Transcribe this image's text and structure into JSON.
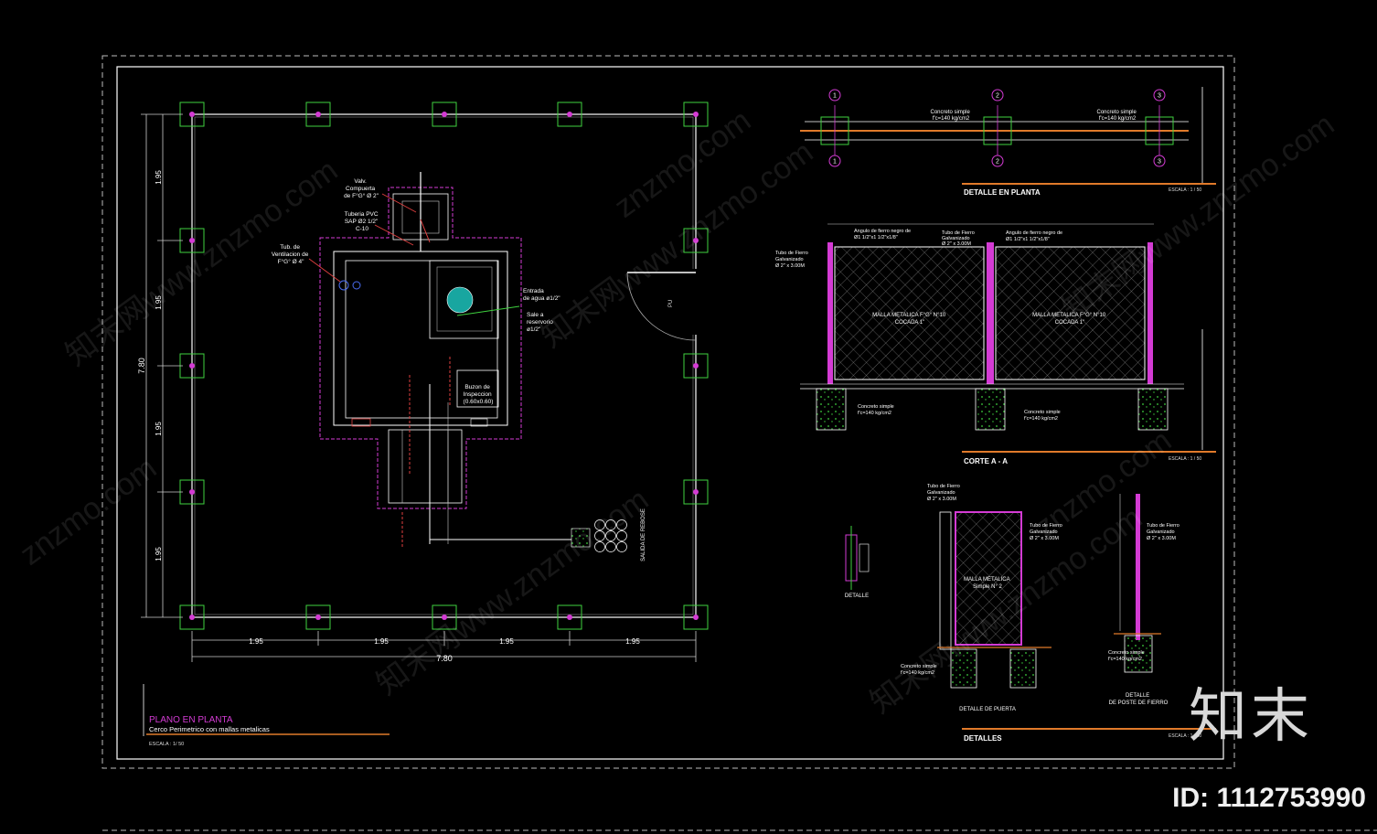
{
  "plan": {
    "title": "PLANO EN PLANTA",
    "subtitle": "Cerco Perimetrico con mallas metalicas",
    "scale": "ESCALA : 1/ 50",
    "dim_segment": "1.95",
    "dim_total": "7.80"
  },
  "notes": {
    "valve": [
      "Valv.",
      "Compuerta",
      "de F°G° Ø 2\""
    ],
    "pvc": [
      "Tuberia PVC",
      "SAP Ø2 1/2\"",
      "C-10"
    ],
    "vent": [
      "Tub. de",
      "Ventilacion de",
      "F°G° Ø 4\""
    ],
    "inlet": [
      "Entrada",
      "de agua ø1/2\""
    ],
    "outlet": [
      "Sale a",
      "reservorio",
      "ø1/2\""
    ],
    "buzon": [
      "Buzon de",
      "Inspeccion",
      "(0.60x0.60)"
    ],
    "salida": "SALIDA DE REBOSE",
    "door_label": "PU"
  },
  "detalle_planta": {
    "title": "DETALLE EN PLANTA",
    "scale": "ESCALA : 1 / 50",
    "concrete": [
      "Concreto simple",
      "f'c=140 kg/cm2"
    ],
    "axes": [
      "1",
      "2",
      "3"
    ]
  },
  "corte": {
    "title": "CORTE A - A",
    "scale": "ESCALA : 1 / 50",
    "mesh": [
      "MALLA METALICA F°G° N°10",
      "COCADA 1\""
    ],
    "tube": [
      "Tubo de Fierro",
      "Galvanizado",
      "Ø 2\" x 3.00M"
    ],
    "angle": [
      "Angulo de fierro negro de",
      "Ø1 1/2\"x1 1/2\"x1/8\""
    ],
    "concrete": [
      "Concreto simple",
      "f'c=140 kg/cm2"
    ]
  },
  "detalles": {
    "title": "DETALLES",
    "scale": "ESCALA : 1 / 50",
    "detalle": "DETALLE",
    "puerta": "DETALLE DE PUERTA",
    "poste": [
      "DETALLE",
      "DE POSTE DE FIERRO"
    ],
    "malla": [
      "MALLA METALICA",
      "Simple N° 2"
    ],
    "tube": [
      "Tubo de Fierro",
      "Galvanizado",
      "Ø 2\" x 3.00M"
    ],
    "concrete": [
      "Concreto simple",
      "f'c=140 kg/cm2"
    ]
  },
  "watermark": {
    "site": "znzmo.com",
    "brand": "知末网www.znzmo.com",
    "logo": "知末",
    "id": "ID: 1112753990"
  }
}
